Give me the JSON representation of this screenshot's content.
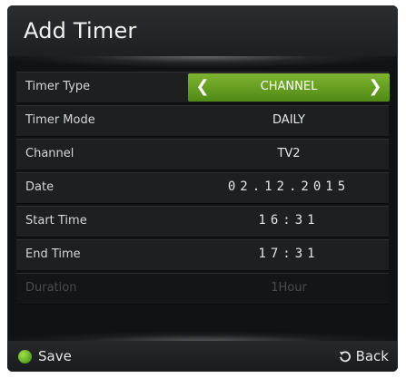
{
  "dialog": {
    "title": "Add Timer"
  },
  "rows": [
    {
      "label": "Timer Type",
      "value": "CHANNEL"
    },
    {
      "label": "Timer Mode",
      "value": "DAILY"
    },
    {
      "label": "Channel",
      "value": "TV2"
    },
    {
      "label": "Date",
      "value": "02.12.2015"
    },
    {
      "label": "Start Time",
      "value": "16:31"
    },
    {
      "label": "End Time",
      "value": "17:31"
    },
    {
      "label": "Duration",
      "value": "1Hour"
    }
  ],
  "footer": {
    "save_label": "Save",
    "back_label": "Back"
  },
  "colors": {
    "accent": "#5f9b1f",
    "background": "#111213"
  }
}
